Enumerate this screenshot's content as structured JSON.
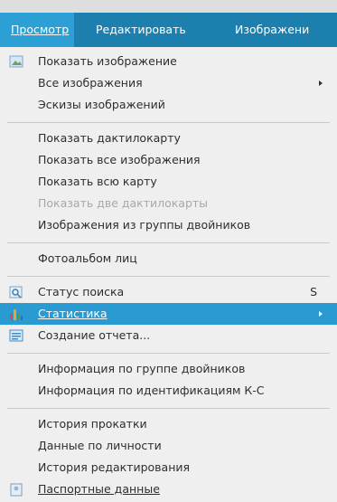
{
  "menubar": {
    "items": [
      {
        "label": "Просмотр",
        "active": true
      },
      {
        "label": "Редактировать",
        "active": false
      },
      {
        "label": "Изображени",
        "active": false
      }
    ]
  },
  "menu": {
    "groups": [
      [
        {
          "label": "Показать изображение",
          "icon": "image-icon"
        },
        {
          "label": "Все изображения",
          "submenu": true
        },
        {
          "label": "Эскизы изображений"
        }
      ],
      [
        {
          "label": "Показать дактилокарту"
        },
        {
          "label": "Показать все изображения"
        },
        {
          "label": "Показать всю карту"
        },
        {
          "label": "Показать две дактилокарты",
          "disabled": true
        },
        {
          "label": "Изображения из группы двойников"
        }
      ],
      [
        {
          "label": "Фотоальбом лиц"
        }
      ],
      [
        {
          "label": "Статус поиска",
          "icon": "search-status-icon",
          "shortcut": "S"
        },
        {
          "label": "Статистика",
          "icon": "statistics-icon",
          "submenu": true,
          "highlighted": true
        },
        {
          "label": "Создание отчета...",
          "icon": "report-icon"
        }
      ],
      [
        {
          "label": "Информация по группе двойников"
        },
        {
          "label": "Информация по идентификациям К-С"
        }
      ],
      [
        {
          "label": "История прокатки"
        },
        {
          "label": "Данные по личности"
        },
        {
          "label": "История редактирования"
        },
        {
          "label": "Паспортные данные",
          "icon": "passport-icon"
        }
      ]
    ]
  },
  "colors": {
    "menubar": "#1d7fae",
    "highlight": "#2a9ad3",
    "menu_bg": "#efefef",
    "disabled_text": "#a8a8a8"
  }
}
